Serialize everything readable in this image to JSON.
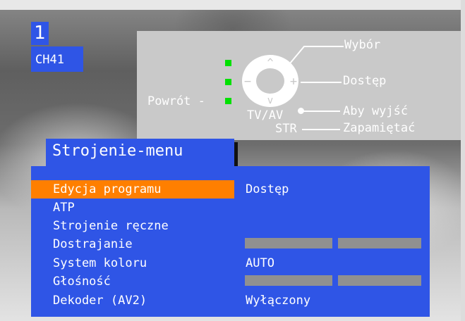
{
  "program": {
    "number": "1",
    "channel": "CH41"
  },
  "legend": {
    "wybor": "Wybór",
    "dostep": "Dostęp",
    "powrot": "Powrót -",
    "tvav": "TV/AV",
    "aby_wyjsc": "Aby wyjść",
    "str": "STR",
    "zapamietac": "Zapamiętać",
    "up_arrow": "^",
    "down_arrow": "v",
    "minus": "−",
    "plus": "+",
    "indicator_color": "#00e000"
  },
  "menu": {
    "title": "Strojenie-menu",
    "items": [
      {
        "label": "Edycja programu",
        "value": "Dostęp",
        "selected": true
      },
      {
        "label": "ATP",
        "value": ""
      },
      {
        "label": "Strojenie ręczne",
        "value": ""
      },
      {
        "label": "Dostrajanie",
        "value": ""
      },
      {
        "label": "System koloru",
        "value": "AUTO"
      },
      {
        "label": "Głośność",
        "value": ""
      },
      {
        "label": "Dekoder (AV2)",
        "value": "Wyłączony"
      }
    ],
    "colors": {
      "panel": "#2f55e6",
      "selected": "#ff7f00"
    }
  }
}
